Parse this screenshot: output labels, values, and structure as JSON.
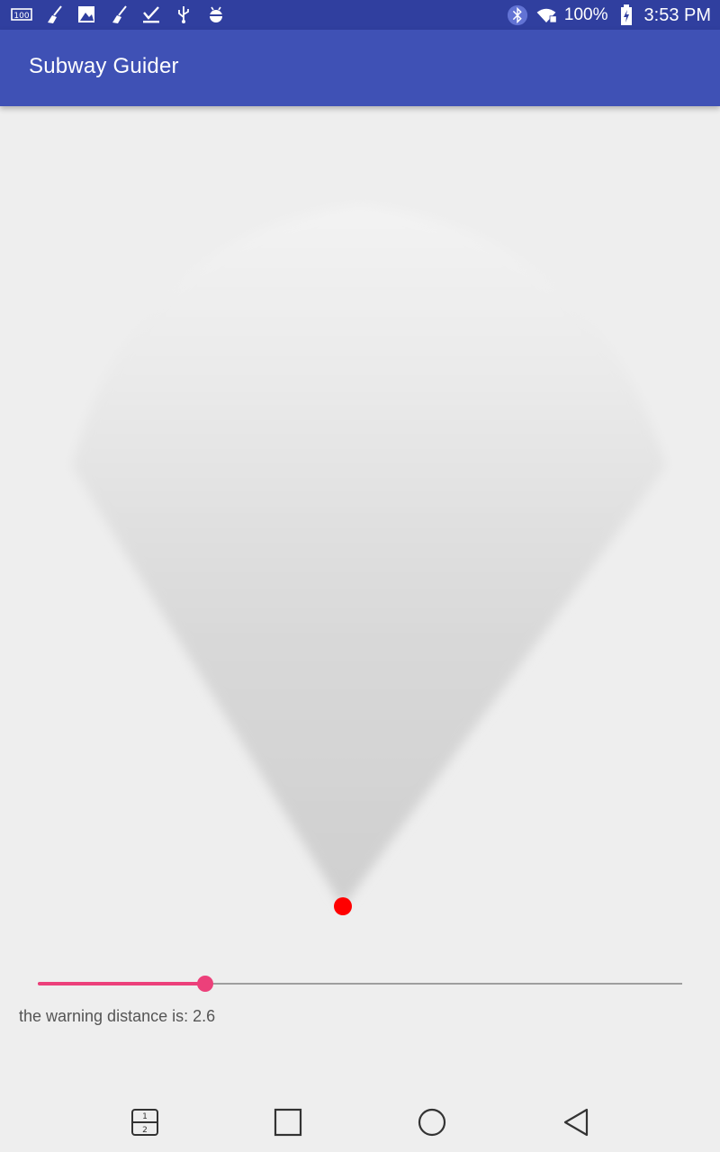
{
  "status_bar": {
    "battery_percent": "100%",
    "time": "3:53 PM",
    "left_icons": [
      "notification-100-icon",
      "broom-icon",
      "image-icon",
      "broom-icon",
      "download-done-icon",
      "usb-icon",
      "android-debug-icon"
    ],
    "right_icons": [
      "bluetooth-icon",
      "wifi-icon",
      "battery-charging-icon"
    ]
  },
  "app_bar": {
    "title": "Subway Guider",
    "color": "#3f51b5",
    "status_color": "#303f9f"
  },
  "seekbar": {
    "progress_fraction": 0.26,
    "accent_color": "#ec407a"
  },
  "warning": {
    "text": "the warning distance is: 2.6"
  },
  "radar": {
    "marker_color": "#ff0000"
  },
  "nav_bar": {
    "buttons": [
      "split-screen-icon",
      "recents-icon",
      "home-icon",
      "back-icon"
    ]
  }
}
